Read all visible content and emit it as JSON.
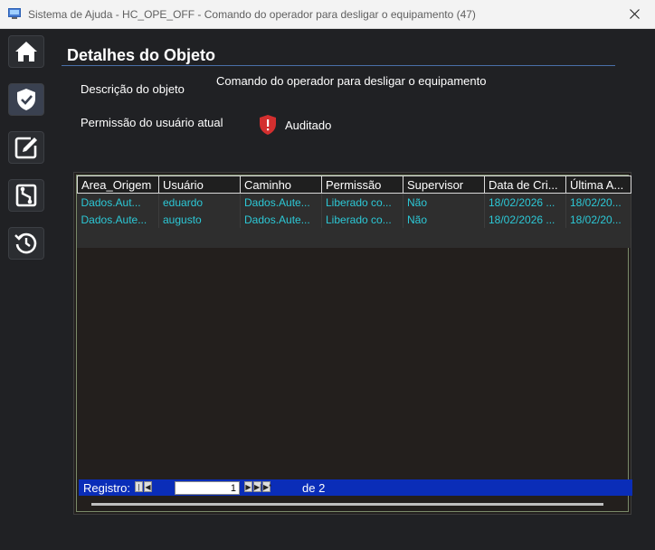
{
  "window": {
    "title": "Sistema de Ajuda - HC_OPE_OFF - Comando do operador para desligar o equipamento (47)",
    "close_icon": "close-icon"
  },
  "sidebar": {
    "items": [
      {
        "name": "home",
        "icon": "home-icon"
      },
      {
        "name": "permissions",
        "icon": "shield-check-icon",
        "active": true
      },
      {
        "name": "edit",
        "icon": "edit-icon"
      },
      {
        "name": "circuit",
        "icon": "circuit-icon"
      },
      {
        "name": "history",
        "icon": "history-icon"
      }
    ]
  },
  "details": {
    "heading": "Detalhes do Objeto",
    "description_label": "Descrição do objeto",
    "description_value": "Comando do operador para desligar o equipamento",
    "permission_label": "Permissão do usuário atual",
    "permission_value": "Auditado",
    "permission_color": "#d32f2f"
  },
  "grid": {
    "columns": [
      "Area_Origem",
      "Usuário",
      "Caminho",
      "Permissão",
      "Supervisor",
      "Data de Cri...",
      "Última A..."
    ],
    "rows": [
      [
        "Dados.Aut...",
        "eduardo",
        "Dados.Aute...",
        "Liberado co...",
        "Não",
        "18/02/2026 ...",
        "18/02/20..."
      ],
      [
        "Dados.Aute...",
        "augusto",
        "Dados.Aute...",
        "Liberado co...",
        "Não",
        "18/02/2026 ...",
        "18/02/20..."
      ]
    ],
    "text_color": "#2cc8d6"
  },
  "navigator": {
    "label": "Registro:",
    "current": "1",
    "of_text": "de 2",
    "bar_color": "#0a2db8"
  }
}
